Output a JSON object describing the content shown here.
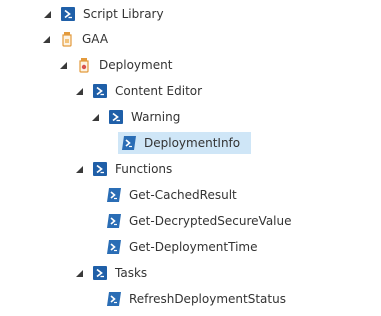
{
  "tree": {
    "script_library": "Script Library",
    "gaa": "GAA",
    "deployment": "Deployment",
    "content_editor": "Content Editor",
    "warning": "Warning",
    "deployment_info": "DeploymentInfo",
    "functions": "Functions",
    "get_cached_result": "Get-CachedResult",
    "get_decrypted_secure_value": "Get-DecryptedSecureValue",
    "get_deployment_time": "Get-DeploymentTime",
    "tasks": "Tasks",
    "refresh_deployment_status": "RefreshDeploymentStatus"
  },
  "icons": {
    "powershell_module": "powershell-module-icon",
    "powershell_script": "powershell-script-icon",
    "jar": "jar-icon",
    "expand_arrow": "expanded-arrow-icon"
  },
  "colors": {
    "powershell_blue": "#1f5fa8",
    "script_blue": "#2a6db5",
    "jar_orange": "#e39a3c",
    "jar_red": "#d9534f",
    "selection": "#cfe6f7"
  }
}
